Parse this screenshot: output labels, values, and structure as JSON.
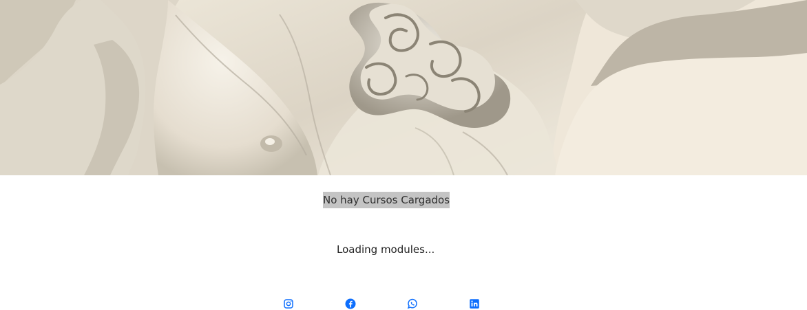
{
  "hero": {
    "image_alt": "statue-torso",
    "colors": {
      "background": "#efe7d9",
      "skin": "#e8e1d2",
      "shadow": "#bfb8a7",
      "hair": "#d8d0c0",
      "line": "#8e877a"
    }
  },
  "courses": {
    "empty_message": "No hay Cursos Cargados"
  },
  "modules": {
    "loading_text": "Loading modules..."
  },
  "social": {
    "accent": "#0d6efd",
    "items": [
      {
        "icon": "instagram-icon"
      },
      {
        "icon": "facebook-icon"
      },
      {
        "icon": "whatsapp-icon"
      },
      {
        "icon": "linkedin-icon"
      }
    ]
  }
}
